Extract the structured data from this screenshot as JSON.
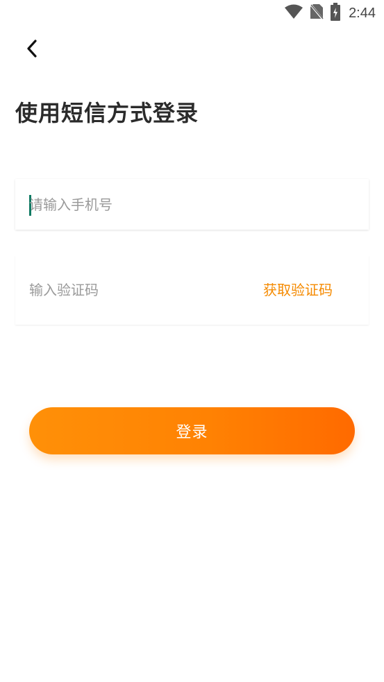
{
  "status_bar": {
    "time": "2:44",
    "icons": [
      "wifi-icon",
      "no-sim-icon",
      "battery-charging-icon"
    ]
  },
  "header": {
    "back_icon": "chevron-left-icon",
    "title": "使用短信方式登录"
  },
  "form": {
    "phone_placeholder": "请输入手机号",
    "code_placeholder": "输入验证码",
    "get_code_label": "获取验证码",
    "login_label": "登录"
  },
  "colors": {
    "accent": "#f58a00",
    "button_start": "#ff9008",
    "button_end": "#ff6a00",
    "cursor": "#0f7a63"
  }
}
